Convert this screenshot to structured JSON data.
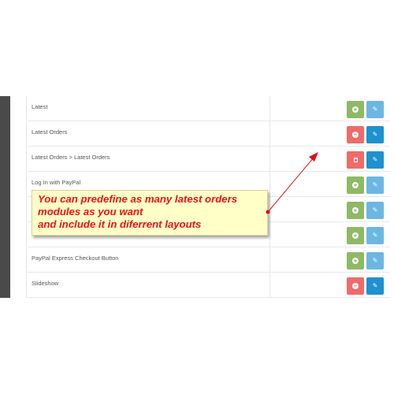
{
  "modules": [
    {
      "label": "Latest",
      "action": "enable",
      "action_icon": "plus-circle-icon",
      "edit_icon": "pencil-icon",
      "action_color": "#8fb965",
      "edit_color": "#6cb7e2"
    },
    {
      "label": "Latest Orders",
      "action": "disable",
      "action_icon": "minus-circle-icon",
      "edit_icon": "pencil-icon",
      "action_color": "#ef6b6b",
      "edit_color": "#1e91cf"
    },
    {
      "label": "Latest Orders > Latest Orders",
      "action": "delete",
      "action_icon": "trash-icon",
      "edit_icon": "pencil-icon",
      "action_color": "#ef6b6b",
      "edit_color": "#1e91cf"
    },
    {
      "label": "Log In with PayPal",
      "action": "enable",
      "action_icon": "plus-circle-icon",
      "edit_icon": "pencil-icon",
      "action_color": "#8fb965",
      "edit_color": "#6cb7e2"
    },
    {
      "label": "",
      "action": "enable",
      "action_icon": "plus-circle-icon",
      "edit_icon": "pencil-icon",
      "action_color": "#8fb965",
      "edit_color": "#6cb7e2"
    },
    {
      "label": "",
      "action": "enable",
      "action_icon": "plus-circle-icon",
      "edit_icon": "pencil-icon",
      "action_color": "#8fb965",
      "edit_color": "#6cb7e2"
    },
    {
      "label": "PayPal Express Checkout Button",
      "action": "enable",
      "action_icon": "plus-circle-icon",
      "edit_icon": "pencil-icon",
      "action_color": "#8fb965",
      "edit_color": "#6cb7e2"
    },
    {
      "label": "Slideshow",
      "action": "disable",
      "action_icon": "minus-circle-icon",
      "edit_icon": "pencil-icon",
      "action_color": "#ef6b6b",
      "edit_color": "#1e91cf"
    }
  ],
  "callout": {
    "lines": [
      "You can predefine as many latest orders",
      "modules as you want",
      "and include it in diferrent layouts"
    ],
    "text_color": "#ee1111",
    "background": "#ffffc8"
  },
  "arrow_color": "#e01010"
}
